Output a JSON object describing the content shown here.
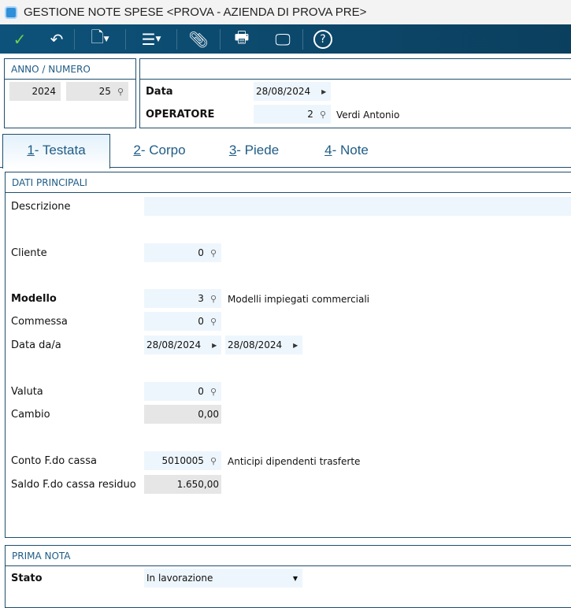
{
  "window": {
    "title": "GESTIONE NOTE SPESE <PROVA - AZIENDA DI PROVA PRE>"
  },
  "toolbar": {
    "items": [
      "check-icon",
      "undo-icon",
      "document-icon",
      "menu-icon",
      "paperclip-icon",
      "printer-icon",
      "monitor-icon",
      "help-icon"
    ]
  },
  "anno_numero": {
    "header": "ANNO / NUMERO",
    "anno": "2024",
    "numero": "25"
  },
  "testata_box": {
    "data_label": "Data",
    "data_value": "28/08/2024",
    "operatore_label": "OPERATORE",
    "operatore_value": "2",
    "operatore_name": "Verdi Antonio"
  },
  "tabs": [
    {
      "num": "1",
      "label": " - Testata"
    },
    {
      "num": "2",
      "label": " - Corpo"
    },
    {
      "num": "3",
      "label": " - Piede"
    },
    {
      "num": "4",
      "label": " - Note"
    }
  ],
  "dati_principali": {
    "header": "DATI PRINCIPALI",
    "descrizione_label": "Descrizione",
    "descrizione_value": "",
    "cliente_label": "Cliente",
    "cliente_value": "0",
    "modello_label": "Modello",
    "modello_value": "3",
    "modello_desc": "Modelli impiegati commerciali",
    "commessa_label": "Commessa",
    "commessa_value": "0",
    "data_label": "Data da/a",
    "data_da": "28/08/2024",
    "data_a": "28/08/2024",
    "valuta_label": "Valuta",
    "valuta_value": "0",
    "cambio_label": "Cambio",
    "cambio_value": "0,00",
    "conto_label": "Conto F.do cassa",
    "conto_value": "5010005",
    "conto_desc": "Anticipi dipendenti trasferte",
    "saldo_label": "Saldo F.do cassa residuo",
    "saldo_value": "1.650,00"
  },
  "prima_nota": {
    "header": "PRIMA NOTA",
    "stato_label": "Stato",
    "stato_value": "In lavorazione"
  }
}
